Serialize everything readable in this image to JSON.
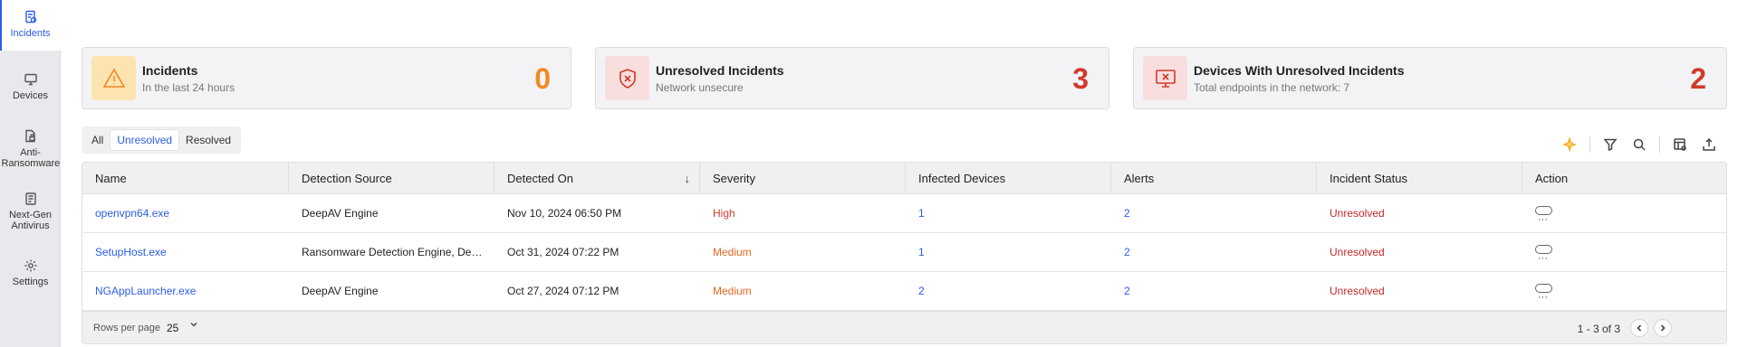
{
  "sidebar": {
    "items": [
      {
        "label": "Incidents",
        "icon": "incidents-icon",
        "active": true
      },
      {
        "label": "Devices",
        "icon": "monitor-icon"
      },
      {
        "label": "Anti-Ransomware",
        "icon": "file-lock-icon"
      },
      {
        "label": "Next-Gen Antivirus",
        "icon": "antivirus-icon"
      },
      {
        "label": "Settings",
        "icon": "gear-icon"
      }
    ]
  },
  "cards": [
    {
      "title": "Incidents",
      "subtitle": "In the last 24 hours",
      "count": "0",
      "icon": "warning-icon",
      "accent": "#f08a24",
      "icon_bg": "#fde3b0"
    },
    {
      "title": "Unresolved Incidents",
      "subtitle": "Network unsecure",
      "count": "3",
      "icon": "shield-x-icon",
      "accent": "#d03a2a",
      "icon_bg": "#f9dede"
    },
    {
      "title": "Devices With Unresolved Incidents",
      "subtitle": "Total endpoints in the network: 7",
      "count": "2",
      "icon": "monitor-x-icon",
      "accent": "#d03a2a",
      "icon_bg": "#f9dede"
    }
  ],
  "filter_tabs": [
    {
      "label": "All"
    },
    {
      "label": "Unresolved",
      "active": true
    },
    {
      "label": "Resolved"
    }
  ],
  "toolbar": {
    "icons": [
      "sparkle-icon",
      "filter-icon",
      "search-icon",
      "columns-settings-icon",
      "export-icon"
    ]
  },
  "table": {
    "columns": [
      "Name",
      "Detection Source",
      "Detected On",
      "Severity",
      "Infected Devices",
      "Alerts",
      "Incident Status",
      "Action"
    ],
    "sorted_column": "Detected On",
    "rows": [
      {
        "name": "openvpn64.exe",
        "source": "DeepAV Engine",
        "detected_on": "Nov 10, 2024 06:50 PM",
        "severity": "High",
        "infected_devices": "1",
        "alerts": "2",
        "status": "Unresolved"
      },
      {
        "name": "SetupHost.exe",
        "source": "Ransomware Detection Engine, DeepAV Engine",
        "detected_on": "Oct 31, 2024 07:22 PM",
        "severity": "Medium",
        "infected_devices": "1",
        "alerts": "2",
        "status": "Unresolved"
      },
      {
        "name": "NGAppLauncher.exe",
        "source": "DeepAV Engine",
        "detected_on": "Oct 27, 2024 07:12 PM",
        "severity": "Medium",
        "infected_devices": "2",
        "alerts": "2",
        "status": "Unresolved"
      }
    ]
  },
  "pagination": {
    "rows_per_page_label": "Rows per page",
    "rows_per_page": "25",
    "range": "1 - 3 of 3"
  },
  "colors": {
    "accent_blue": "#2b5ce6",
    "severity_high": "#d23a2a",
    "severity_medium": "#e3681f",
    "status_unresolved": "#c62828"
  }
}
